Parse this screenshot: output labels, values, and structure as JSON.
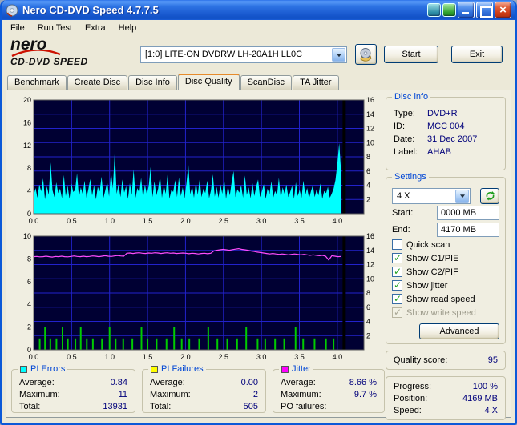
{
  "window": {
    "title": "Nero CD-DVD Speed 4.7.7.5"
  },
  "menu": {
    "items": [
      "File",
      "Run Test",
      "Extra",
      "Help"
    ]
  },
  "logo": {
    "brand": "nero",
    "product": "CD-DVD SPEED"
  },
  "toolbar": {
    "drive_selector": "[1:0]   LITE-ON DVDRW LH-20A1H LL0C",
    "start_button": "Start",
    "exit_button": "Exit"
  },
  "tabs": {
    "items": [
      "Benchmark",
      "Create Disc",
      "Disc Info",
      "Disc Quality",
      "ScanDisc",
      "TA Jitter"
    ],
    "active": "Disc Quality"
  },
  "disc_info": {
    "title": "Disc info",
    "rows": [
      {
        "label": "Type:",
        "value": "DVD+R"
      },
      {
        "label": "ID:",
        "value": "MCC 004"
      },
      {
        "label": "Date:",
        "value": "31 Dec 2007"
      },
      {
        "label": "Label:",
        "value": "AHAB"
      }
    ]
  },
  "settings": {
    "title": "Settings",
    "speed_value": "4 X",
    "start_label": "Start:",
    "start_value": "0000 MB",
    "end_label": "End:",
    "end_value": "4170 MB",
    "checkboxes": [
      {
        "label": "Quick scan",
        "checked": false
      },
      {
        "label": "Show C1/PIE",
        "checked": true
      },
      {
        "label": "Show C2/PIF",
        "checked": true
      },
      {
        "label": "Show jitter",
        "checked": true
      },
      {
        "label": "Show read speed",
        "checked": true
      },
      {
        "label": "Show write speed",
        "checked": true,
        "disabled": true
      }
    ],
    "advanced_button": "Advanced"
  },
  "quality": {
    "label": "Quality score:",
    "value": "95"
  },
  "progress": {
    "rows": [
      {
        "label": "Progress:",
        "value": "100 %"
      },
      {
        "label": "Position:",
        "value": "4169 MB"
      },
      {
        "label": "Speed:",
        "value": "4 X"
      }
    ]
  },
  "legends": [
    {
      "title": "PI Errors",
      "color": "#00FFFF",
      "rows": [
        {
          "label": "Average:",
          "value": "0.84"
        },
        {
          "label": "Maximum:",
          "value": "11"
        },
        {
          "label": "Total:",
          "value": "13931"
        }
      ]
    },
    {
      "title": "PI Failures",
      "color": "#FFFF00",
      "rows": [
        {
          "label": "Average:",
          "value": "0.00"
        },
        {
          "label": "Maximum:",
          "value": "2"
        },
        {
          "label": "Total:",
          "value": "505"
        }
      ]
    },
    {
      "title": "Jitter",
      "color": "#FF00FF",
      "rows": [
        {
          "label": "Average:",
          "value": "8.66 %"
        },
        {
          "label": "Maximum:",
          "value": "9.7 %"
        },
        {
          "label": "PO failures:",
          "value": ""
        }
      ]
    }
  ],
  "chart_data": [
    {
      "type": "area",
      "title": "PI Errors vs disc position",
      "x_min": 0,
      "x_max": 4.35,
      "x_ticks": [
        0,
        0.5,
        1.0,
        1.5,
        2.0,
        2.5,
        3.0,
        3.5,
        4.0
      ],
      "x_tick_labels": [
        "0.0",
        "0.5",
        "1.0",
        "1.5",
        "2.0",
        "2.5",
        "3.0",
        "3.5",
        "4.0"
      ],
      "left_axis": {
        "min": 0,
        "max": 20,
        "ticks": [
          0,
          4,
          8,
          12,
          16,
          20
        ]
      },
      "right_axis": {
        "min": 0,
        "max": 16,
        "ticks": [
          2,
          4,
          6,
          8,
          10,
          12,
          14,
          16
        ]
      },
      "plot_bg": "#000033",
      "grid_color": "#2222CC",
      "grid_divisions": 8,
      "end_marker_x": 4.09,
      "series": [
        {
          "name": "PI Errors",
          "kind": "area",
          "color": "#00FFFF",
          "x_start": 0,
          "x_end": 4.05,
          "values": [
            3.2,
            4.5,
            2.8,
            5.1,
            3.9,
            6.2,
            2.5,
            4.8,
            3.3,
            9.0,
            4.1,
            2.9,
            5.5,
            3.6,
            4.4,
            2.7,
            6.8,
            3.1,
            4.9,
            2.6,
            5.3,
            3.8,
            4.2,
            7.1,
            2.9,
            4.6,
            3.4,
            5.8,
            2.8,
            4.3,
            6.1,
            3.2,
            5.0,
            2.5,
            4.7,
            3.9,
            6.5,
            2.8,
            4.1,
            5.6,
            3.0,
            7.4,
            4.4,
            11.0,
            3.5,
            5.2,
            2.9,
            6.0,
            3.7,
            4.8,
            2.6,
            5.4,
            3.3,
            7.8,
            2.8,
            4.5,
            3.6,
            6.3,
            2.7,
            5.1,
            3.4,
            4.9,
            8.2,
            2.9,
            5.7,
            3.2,
            4.4,
            6.6,
            2.8,
            5.0,
            3.5,
            7.0,
            2.6,
            4.2,
            3.8,
            5.9,
            2.9,
            6.4,
            3.1,
            4.6,
            2.7,
            5.3,
            8.6,
            3.4,
            4.8,
            2.8,
            5.5,
            3.3,
            6.1,
            2.9,
            4.4,
            3.6,
            5.8,
            2.7,
            4.1,
            6.9,
            3.0,
            4.7,
            2.8,
            5.2,
            3.5,
            6.2,
            2.6,
            4.9,
            3.2,
            5.6,
            7.5,
            2.9,
            4.3,
            3.7,
            5.0,
            2.8,
            6.7,
            3.3,
            4.6,
            2.7,
            5.4,
            3.1,
            4.8,
            6.0,
            2.9,
            3.9,
            5.2,
            2.6,
            4.4,
            3.4,
            5.7,
            2.8,
            4.0,
            3.2,
            6.3,
            2.7,
            4.6,
            3.5,
            5.1,
            2.9,
            3.8,
            4.9,
            2.6,
            5.5,
            3.1,
            4.2,
            2.8,
            5.8,
            3.3,
            4.5,
            2.7,
            3.9,
            5.0,
            2.9,
            4.3,
            3.2,
            5.3,
            2.6,
            4.0,
            3.6,
            4.7,
            2.8,
            3.5,
            4.4,
            5.9,
            8.8,
            12.4,
            7.2
          ]
        }
      ]
    },
    {
      "type": "line",
      "title": "Jitter and PI Failures vs disc position",
      "x_min": 0,
      "x_max": 4.35,
      "x_ticks": [
        0,
        0.5,
        1.0,
        1.5,
        2.0,
        2.5,
        3.0,
        3.5,
        4.0
      ],
      "x_tick_labels": [
        "0.0",
        "0.5",
        "1.0",
        "1.5",
        "2.0",
        "2.5",
        "3.0",
        "3.5",
        "4.0"
      ],
      "left_axis": {
        "min": 0,
        "max": 10,
        "ticks": [
          0,
          2,
          4,
          6,
          8,
          10
        ]
      },
      "right_axis": {
        "min": 0,
        "max": 16,
        "ticks": [
          2,
          4,
          6,
          8,
          10,
          12,
          14,
          16
        ]
      },
      "plot_bg": "#000033",
      "grid_color": "#2222CC",
      "grid_divisions": 8,
      "end_marker_x": 4.09,
      "series": [
        {
          "name": "PI Failures",
          "kind": "bars",
          "color": "#00CC00",
          "points": [
            [
              0.08,
              1
            ],
            [
              0.15,
              2
            ],
            [
              0.22,
              1
            ],
            [
              0.3,
              1
            ],
            [
              0.38,
              2
            ],
            [
              0.45,
              1
            ],
            [
              0.55,
              1
            ],
            [
              0.62,
              2
            ],
            [
              0.7,
              1
            ],
            [
              0.78,
              1
            ],
            [
              0.9,
              1
            ],
            [
              1.0,
              2
            ],
            [
              1.08,
              1
            ],
            [
              1.18,
              1
            ],
            [
              1.3,
              1
            ],
            [
              1.42,
              2
            ],
            [
              1.5,
              1
            ],
            [
              1.62,
              1
            ],
            [
              1.75,
              1
            ],
            [
              1.85,
              2
            ],
            [
              1.95,
              1
            ],
            [
              2.05,
              1
            ],
            [
              2.18,
              1
            ],
            [
              2.3,
              2
            ],
            [
              2.42,
              1
            ],
            [
              2.55,
              1
            ],
            [
              2.68,
              1
            ],
            [
              2.8,
              2
            ],
            [
              2.95,
              1
            ],
            [
              3.05,
              1
            ],
            [
              3.18,
              1
            ],
            [
              3.3,
              1
            ],
            [
              3.45,
              2
            ],
            [
              3.55,
              1
            ],
            [
              3.7,
              1
            ],
            [
              3.85,
              1
            ],
            [
              3.95,
              1
            ]
          ]
        },
        {
          "name": "Jitter",
          "kind": "line",
          "color": "#FF4DFF",
          "x_start": 0,
          "x_end": 4.05,
          "values": [
            8.2,
            8.22,
            8.18,
            8.2,
            8.24,
            8.2,
            8.16,
            8.22,
            8.2,
            8.24,
            8.2,
            8.18,
            8.22,
            8.26,
            8.22,
            8.2,
            8.24,
            8.2,
            8.22,
            8.26,
            8.24,
            8.2,
            8.24,
            8.28,
            8.24,
            8.22,
            8.26,
            8.3,
            8.26,
            8.24,
            8.5,
            8.52,
            8.48,
            8.52,
            8.54,
            8.5,
            8.48,
            8.52,
            8.5,
            8.54,
            8.52,
            8.48,
            8.52,
            8.54,
            8.5,
            8.52,
            8.48,
            8.5,
            8.52,
            8.5,
            8.46,
            8.5,
            8.48,
            8.44,
            8.48,
            8.5,
            8.46,
            8.5,
            8.7,
            8.76,
            8.8,
            8.84,
            8.8,
            8.76,
            8.82,
            8.86,
            8.9,
            8.84,
            8.8,
            8.76,
            8.7,
            8.66,
            8.6,
            8.56,
            8.52,
            8.48,
            8.44,
            8.48,
            8.44,
            8.4,
            8.44,
            8.4,
            8.36,
            8.4,
            8.44,
            8.4,
            8.36,
            8.4,
            8.36,
            8.32,
            8.36,
            8.32,
            8.28,
            8.32,
            8.24,
            7.9,
            8.28,
            8.24,
            8.2,
            8.22
          ]
        }
      ]
    }
  ]
}
